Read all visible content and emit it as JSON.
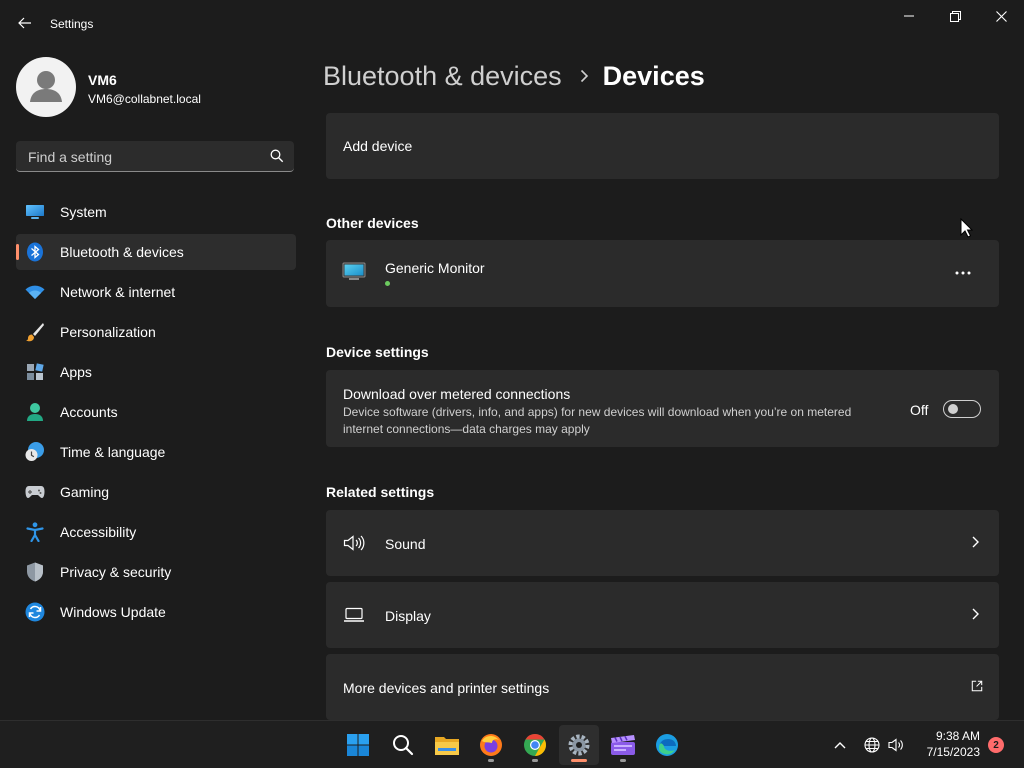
{
  "window": {
    "title": "Settings",
    "back_icon": "back-arrow-icon",
    "controls": [
      "minimize-icon",
      "maximize-icon",
      "close-icon"
    ]
  },
  "user": {
    "name": "VM6",
    "email": "VM6@collabnet.local"
  },
  "search": {
    "placeholder": "Find a setting",
    "value": ""
  },
  "sidebar": {
    "items": [
      {
        "label": "System",
        "icon": "system-icon"
      },
      {
        "label": "Bluetooth & devices",
        "icon": "bluetooth-icon",
        "active": true
      },
      {
        "label": "Network & internet",
        "icon": "wifi-icon"
      },
      {
        "label": "Personalization",
        "icon": "brush-icon"
      },
      {
        "label": "Apps",
        "icon": "apps-icon"
      },
      {
        "label": "Accounts",
        "icon": "accounts-icon"
      },
      {
        "label": "Time & language",
        "icon": "clock-globe-icon"
      },
      {
        "label": "Gaming",
        "icon": "gamepad-icon"
      },
      {
        "label": "Accessibility",
        "icon": "accessibility-icon"
      },
      {
        "label": "Privacy & security",
        "icon": "shield-icon"
      },
      {
        "label": "Windows Update",
        "icon": "update-icon"
      }
    ]
  },
  "breadcrumb": {
    "parent": "Bluetooth & devices",
    "current": "Devices"
  },
  "main": {
    "add_device": "Add device",
    "other_devices": {
      "title": "Other devices",
      "device_name": "Generic Monitor",
      "status_color": "#6ccb5f"
    },
    "device_settings": {
      "title": "Device settings",
      "metered": {
        "title": "Download over metered connections",
        "description": "Device software (drivers, info, and apps) for new devices will download when you’re on metered internet connections—data charges may apply",
        "state": "Off"
      }
    },
    "related": {
      "title": "Related settings",
      "sound": "Sound",
      "display": "Display",
      "more_devices": "More devices and printer settings"
    }
  },
  "taskbar": {
    "apps": [
      "windows-start-icon",
      "search-icon",
      "file-explorer-icon",
      "firefox-icon",
      "chrome-icon",
      "settings-icon",
      "clapperboard-icon",
      "edge-icon"
    ],
    "time": "9:38 AM",
    "date": "7/15/2023",
    "notifications": "2"
  },
  "colors": {
    "accent": "#ff8f6b",
    "background": "#1c1c1c",
    "card": "#2b2b2b"
  }
}
